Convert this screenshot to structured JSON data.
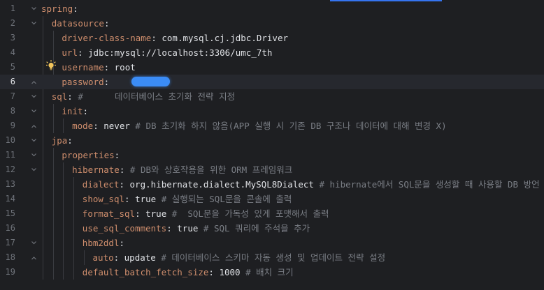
{
  "editor": {
    "language": "yaml",
    "current_line": 6,
    "lines": [
      {
        "n": "1",
        "indent": 0,
        "fold": "chev",
        "parts": [
          {
            "t": "spring",
            "c": "key"
          },
          {
            "t": ":",
            "c": "val"
          }
        ]
      },
      {
        "n": "2",
        "indent": 1,
        "fold": "chev",
        "parts": [
          {
            "t": "datasource",
            "c": "key"
          },
          {
            "t": ":",
            "c": "val"
          }
        ]
      },
      {
        "n": "3",
        "indent": 2,
        "fold": "",
        "parts": [
          {
            "t": "driver-class-name",
            "c": "key"
          },
          {
            "t": ": com.mysql.cj.jdbc.Driver",
            "c": "val"
          }
        ]
      },
      {
        "n": "4",
        "indent": 2,
        "fold": "",
        "parts": [
          {
            "t": "url",
            "c": "key"
          },
          {
            "t": ": jdbc:mysql://localhost:3306/umc_7th",
            "c": "val"
          }
        ]
      },
      {
        "n": "5",
        "indent": 2,
        "fold": "",
        "parts": [
          {
            "t": "username",
            "c": "key"
          },
          {
            "t": ": root",
            "c": "val"
          }
        ]
      },
      {
        "n": "6",
        "indent": 2,
        "fold": "end",
        "parts": [
          {
            "t": "password",
            "c": "key"
          },
          {
            "t": ":",
            "c": "val"
          }
        ]
      },
      {
        "n": "7",
        "indent": 1,
        "fold": "chev",
        "parts": [
          {
            "t": "sql",
            "c": "key"
          },
          {
            "t": ": ",
            "c": "val"
          },
          {
            "t": "#      데이터베이스 초기화 전략 지정",
            "c": "comment"
          }
        ]
      },
      {
        "n": "8",
        "indent": 2,
        "fold": "chev",
        "parts": [
          {
            "t": "init",
            "c": "key"
          },
          {
            "t": ":",
            "c": "val"
          }
        ]
      },
      {
        "n": "9",
        "indent": 3,
        "fold": "end",
        "parts": [
          {
            "t": "mode",
            "c": "key"
          },
          {
            "t": ": never ",
            "c": "val"
          },
          {
            "t": "# ",
            "c": "comment"
          },
          {
            "t": "DB",
            "c": "comment it"
          },
          {
            "t": " 초기화 하지 않음(",
            "c": "comment"
          },
          {
            "t": "APP",
            "c": "comment it"
          },
          {
            "t": " 실행 시 기존 ",
            "c": "comment"
          },
          {
            "t": "DB",
            "c": "comment it"
          },
          {
            "t": " 구조나 데이터에 대해 변경 ",
            "c": "comment"
          },
          {
            "t": "X",
            "c": "comment it"
          },
          {
            "t": ")",
            "c": "comment"
          }
        ]
      },
      {
        "n": "10",
        "indent": 1,
        "fold": "chev",
        "parts": [
          {
            "t": "jpa",
            "c": "key"
          },
          {
            "t": ":",
            "c": "val"
          }
        ]
      },
      {
        "n": "11",
        "indent": 2,
        "fold": "chev",
        "parts": [
          {
            "t": "properties",
            "c": "key"
          },
          {
            "t": ":",
            "c": "val"
          }
        ]
      },
      {
        "n": "12",
        "indent": 3,
        "fold": "chev",
        "parts": [
          {
            "t": "hibernate",
            "c": "key"
          },
          {
            "t": ": ",
            "c": "val"
          },
          {
            "t": "# ",
            "c": "comment"
          },
          {
            "t": "DB",
            "c": "comment it"
          },
          {
            "t": "와 상호작용을 위한 ",
            "c": "comment"
          },
          {
            "t": "ORM",
            "c": "comment it"
          },
          {
            "t": " 프레임워크",
            "c": "comment"
          }
        ]
      },
      {
        "n": "13",
        "indent": 4,
        "fold": "",
        "parts": [
          {
            "t": "dialect",
            "c": "key"
          },
          {
            "t": ": org.hibernate.dialect.MySQL8Dialect ",
            "c": "val"
          },
          {
            "t": "# ",
            "c": "comment"
          },
          {
            "t": "hibernate",
            "c": "comment sq"
          },
          {
            "t": "에서 ",
            "c": "comment"
          },
          {
            "t": "SQL",
            "c": "comment sq"
          },
          {
            "t": "문을 생성할 때 사용할 ",
            "c": "comment"
          },
          {
            "t": "DB",
            "c": "comment it"
          },
          {
            "t": " 방언 지정",
            "c": "comment"
          }
        ]
      },
      {
        "n": "14",
        "indent": 4,
        "fold": "",
        "parts": [
          {
            "t": "show_sql",
            "c": "key"
          },
          {
            "t": ": true ",
            "c": "val"
          },
          {
            "t": "# 실행되는 ",
            "c": "comment"
          },
          {
            "t": "SQL",
            "c": "comment sq"
          },
          {
            "t": "문을 콘솔에 출력",
            "c": "comment"
          }
        ]
      },
      {
        "n": "15",
        "indent": 4,
        "fold": "",
        "parts": [
          {
            "t": "format_sql",
            "c": "key"
          },
          {
            "t": ": true ",
            "c": "val"
          },
          {
            "t": "#  ",
            "c": "comment"
          },
          {
            "t": "SQL",
            "c": "comment sq"
          },
          {
            "t": "문을 가독성 있게 포맷해서 출력",
            "c": "comment"
          }
        ]
      },
      {
        "n": "16",
        "indent": 4,
        "fold": "",
        "parts": [
          {
            "t": "use_sql_comments",
            "c": "key"
          },
          {
            "t": ": true ",
            "c": "val"
          },
          {
            "t": "# ",
            "c": "comment"
          },
          {
            "t": "SQL",
            "c": "comment it"
          },
          {
            "t": " 쿼리에 주석을 추가",
            "c": "comment"
          }
        ]
      },
      {
        "n": "17",
        "indent": 4,
        "fold": "chev",
        "parts": [
          {
            "t": "hbm2ddl",
            "c": "key"
          },
          {
            "t": ":",
            "c": "val"
          }
        ]
      },
      {
        "n": "18",
        "indent": 5,
        "fold": "end",
        "parts": [
          {
            "t": "auto",
            "c": "key"
          },
          {
            "t": ": update ",
            "c": "val"
          },
          {
            "t": "# 데이터베이스 스키마 자동 생성 및 업데이트 전략 설정",
            "c": "comment"
          }
        ]
      },
      {
        "n": "19",
        "indent": 4,
        "fold": "",
        "parts": [
          {
            "t": "default_batch_fetch_size",
            "c": "key"
          },
          {
            "t": ": 1000 ",
            "c": "val"
          },
          {
            "t": "# 배치 크기",
            "c": "comment"
          }
        ]
      }
    ]
  },
  "icons": {
    "intention": "lightbulb-icon",
    "fold_open": "chevron-down-icon",
    "fold_end": "fold-end-icon"
  },
  "colors": {
    "background": "#1e1f22",
    "current_line": "#26282e",
    "key": "#cf8e6d",
    "value": "#dfe1e5",
    "comment": "#7a7e85",
    "accent": "#3574f0",
    "redaction": "#3b8cf6",
    "bulb": "#f2c55c"
  }
}
